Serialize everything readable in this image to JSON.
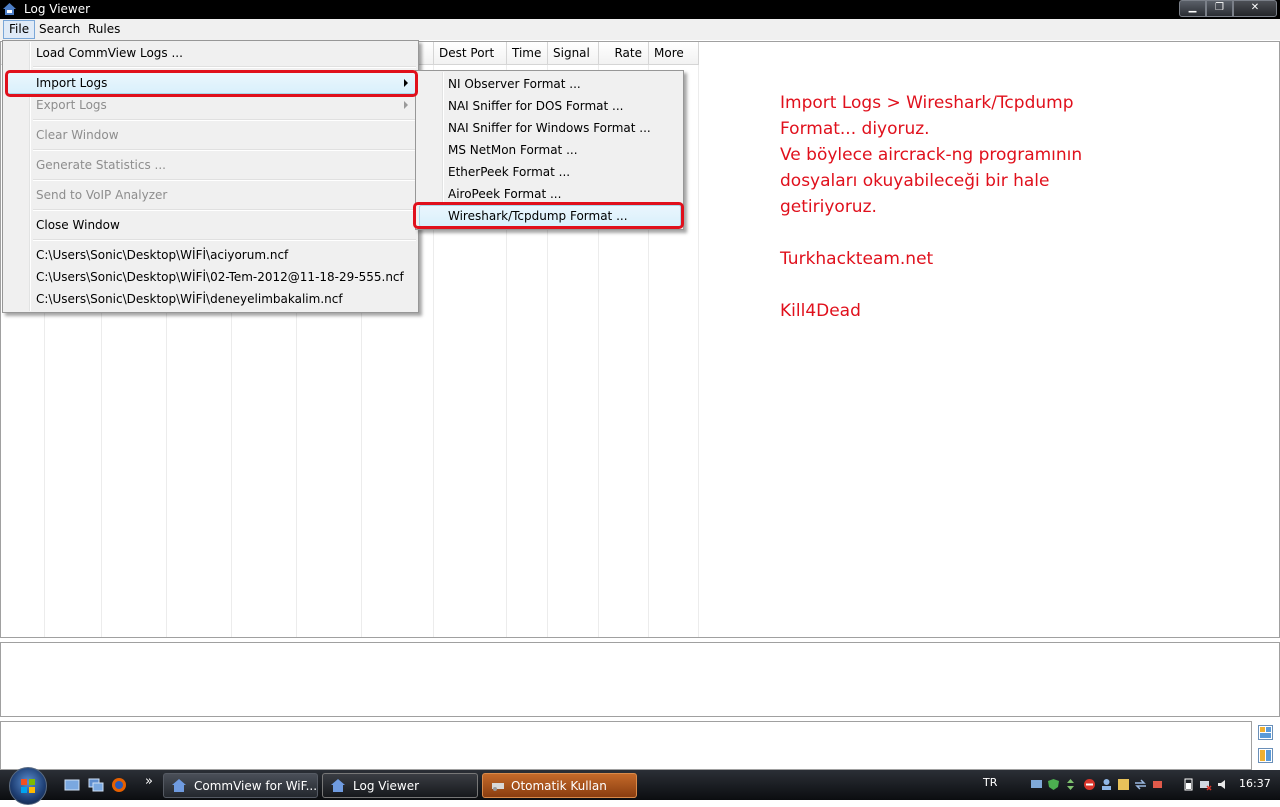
{
  "window": {
    "title": "Log Viewer"
  },
  "menubar": {
    "items": [
      "File",
      "Search",
      "Rules"
    ]
  },
  "grid": {
    "headers": [
      "Dest Port",
      "Time",
      "Signal",
      "Rate",
      "More ..."
    ]
  },
  "file_menu": {
    "items": [
      {
        "label": "Load CommView Logs ...",
        "disabled": false
      },
      {
        "label": "Import Logs",
        "disabled": false,
        "submenu": true
      },
      {
        "label": "Export Logs",
        "disabled": true,
        "submenu": true
      },
      {
        "label": "Clear Window",
        "disabled": true
      },
      {
        "label": "Generate Statistics ...",
        "disabled": true
      },
      {
        "label": "Send to VoIP Analyzer",
        "disabled": true
      },
      {
        "label": "Close Window",
        "disabled": false
      }
    ],
    "recent_files": [
      "C:\\Users\\Sonic\\Desktop\\WİFİ\\aciyorum.ncf",
      "C:\\Users\\Sonic\\Desktop\\WİFİ\\02-Tem-2012@11-18-29-555.ncf",
      "C:\\Users\\Sonic\\Desktop\\WİFİ\\deneyelimbakalim.ncf"
    ]
  },
  "import_submenu": {
    "items": [
      "NI Observer Format ...",
      "NAI Sniffer for DOS Format ...",
      "NAI Sniffer for Windows Format ...",
      "MS NetMon Format ...",
      "EtherPeek Format ...",
      "AiroPeek Format ...",
      "Wireshark/Tcpdump Format ..."
    ],
    "highlighted": "Wireshark/Tcpdump Format ..."
  },
  "annotation": {
    "lines": [
      "Import Logs > Wireshark/Tcpdump",
      "Format... diyoruz.",
      "Ve böylece aircrack-ng programının",
      "dosyaları okuyabileceği bir hale",
      "getiriyoruz.",
      "",
      "Turkhackteam.net",
      "",
      "Kill4Dead"
    ],
    "color": "#e0101c"
  },
  "taskbar": {
    "buttons": [
      "CommView for WiF...",
      "Log Viewer",
      "Otomatik Kullan"
    ],
    "language": "TR",
    "clock": "16:37",
    "overflow": "»"
  },
  "colors": {
    "accent_red": "#e0101c",
    "menu_bg": "#f0f0f0",
    "highlight": "#d9f0fc"
  }
}
